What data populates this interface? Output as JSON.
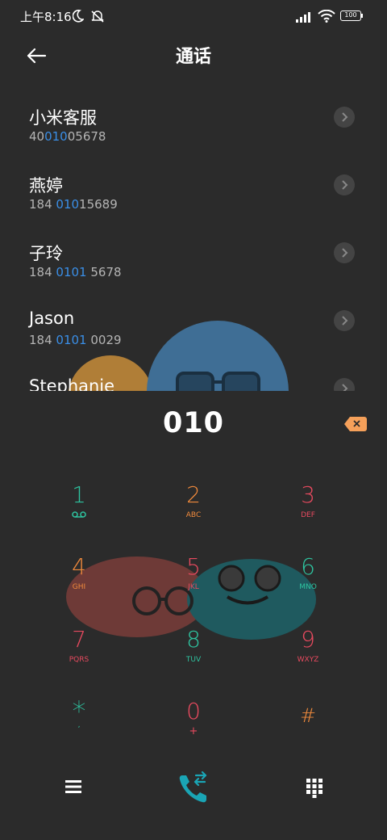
{
  "status_bar": {
    "time": "上午8:16",
    "battery": "100"
  },
  "header": {
    "title": "通话"
  },
  "contacts": [
    {
      "name": "小米客服",
      "num_pre": "40",
      "num_hl": "010",
      "num_post": "05678"
    },
    {
      "name": "燕婷",
      "num_pre": "184 ",
      "num_hl": "010",
      "num_post": "15689"
    },
    {
      "name": "子玲",
      "num_pre": "184 ",
      "num_hl": "0101",
      "num_post": " 5678"
    },
    {
      "name": "Jason",
      "num_pre": "184 ",
      "num_hl": "0101",
      "num_post": " 0029"
    },
    {
      "name": "Stephanie",
      "num_pre": "",
      "num_hl": "",
      "num_post": ""
    }
  ],
  "dialer": {
    "input": "010",
    "keys": [
      {
        "digit": "1",
        "sub": "",
        "color": "#2ec4a0"
      },
      {
        "digit": "2",
        "sub": "ABC",
        "color": "#f08a3c"
      },
      {
        "digit": "3",
        "sub": "DEF",
        "color": "#e84a5f"
      },
      {
        "digit": "4",
        "sub": "GHI",
        "color": "#f08a3c"
      },
      {
        "digit": "5",
        "sub": "JKL",
        "color": "#e84a5f"
      },
      {
        "digit": "6",
        "sub": "MNO",
        "color": "#2ec4a0"
      },
      {
        "digit": "7",
        "sub": "PQRS",
        "color": "#e84a5f"
      },
      {
        "digit": "8",
        "sub": "TUV",
        "color": "#2ec4a0"
      },
      {
        "digit": "9",
        "sub": "WXYZ",
        "color": "#e84a5f"
      },
      {
        "digit": "*",
        "sub": ",",
        "color": "#2ec4a0"
      },
      {
        "digit": "0",
        "sub": "+",
        "color": "#e84a5f"
      },
      {
        "digit": "#",
        "sub": "",
        "color": "#f08a3c"
      }
    ]
  },
  "colors": {
    "accent_blue": "#3a8ee6",
    "call_teal": "#1aa5b5",
    "backspace_orange": "#f5a05a"
  }
}
